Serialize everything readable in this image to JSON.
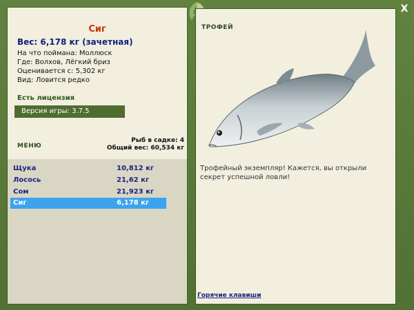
{
  "window": {
    "close_label": "X"
  },
  "fish": {
    "name": "Сиг",
    "weight_line": "Вес: 6,178 кг (зачетная)",
    "caught_on": "На что поймана: Моллюск",
    "where": "Где: Волхов, Лёгкий бриз",
    "valued_from": "Оценивается с: 5,302 кг",
    "type": "Вид: Ловится редко"
  },
  "license": "Есть лицензия",
  "version": "Версия игры: 3.7.5",
  "cage": {
    "count": "Рыб в садке: 4",
    "total": "Общий вес: 60,534 кг"
  },
  "menu_label": "МЕНЮ",
  "catch_list": [
    {
      "name": "Щука",
      "weight": "10,812 кг"
    },
    {
      "name": "Лосось",
      "weight": "21,62 кг"
    },
    {
      "name": "Сом",
      "weight": "21,923 кг"
    },
    {
      "name": "Сиг",
      "weight": "6,178 кг"
    }
  ],
  "trophy": {
    "title": "ТРОФЕЙ",
    "text": "Трофейный экземпляр! Кажется, вы открыли секрет успешной ловли!"
  },
  "hotkeys": "Горячие клавиши",
  "colors": {
    "frame": "#557637",
    "panel": "#f2efdf",
    "selected": "#3ba3f0",
    "fish_name": "#cc3300",
    "link": "#1a2380"
  }
}
